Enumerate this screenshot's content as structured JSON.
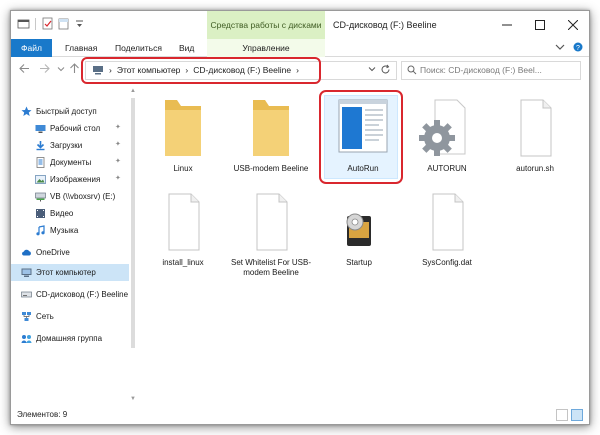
{
  "window": {
    "title": "CD-дисковод (F:) Beeline",
    "context_tab_header": "Средства работы с дисками"
  },
  "ribbon": {
    "tabs": [
      "Файл",
      "Главная",
      "Поделиться",
      "Вид",
      "Управление"
    ]
  },
  "address": {
    "crumbs": [
      "Этот компьютер",
      "CD-дисковод (F:) Beeline"
    ],
    "search_placeholder": "Поиск: CD-дисковод (F:) Beel..."
  },
  "sidebar": {
    "items": [
      {
        "label": "Быстрый доступ",
        "icon": "star-icon",
        "pinned": false
      },
      {
        "label": "Рабочий стол",
        "icon": "desktop-icon",
        "pinned": true
      },
      {
        "label": "Загрузки",
        "icon": "download-icon",
        "pinned": true
      },
      {
        "label": "Документы",
        "icon": "documents-icon",
        "pinned": true
      },
      {
        "label": "Изображения",
        "icon": "pictures-icon",
        "pinned": true
      },
      {
        "label": "VB (\\\\vboxsrv) (E:)",
        "icon": "network-drive-icon",
        "pinned": false
      },
      {
        "label": "Видео",
        "icon": "video-icon",
        "pinned": false
      },
      {
        "label": "Музыка",
        "icon": "music-icon",
        "pinned": false
      },
      {
        "label": "OneDrive",
        "icon": "cloud-icon",
        "pinned": false
      },
      {
        "label": "Этот компьютер",
        "icon": "computer-icon",
        "pinned": false
      },
      {
        "label": "CD-дисковод (F:) Beeline",
        "icon": "cd-drive-icon",
        "pinned": false
      },
      {
        "label": "Сеть",
        "icon": "network-icon",
        "pinned": false
      },
      {
        "label": "Домашняя группа",
        "icon": "homegroup-icon",
        "pinned": false
      }
    ]
  },
  "files": [
    {
      "name": "Linux",
      "kind": "folder"
    },
    {
      "name": "USB-modem Beeline",
      "kind": "folder"
    },
    {
      "name": "AutoRun",
      "kind": "exe"
    },
    {
      "name": "AUTORUN",
      "kind": "settings"
    },
    {
      "name": "autorun.sh",
      "kind": "file"
    },
    {
      "name": "install_linux",
      "kind": "file"
    },
    {
      "name": "Set Whitelist For USB-modem Beeline",
      "kind": "file"
    },
    {
      "name": "Startup",
      "kind": "app"
    },
    {
      "name": "SysConfig.dat",
      "kind": "file"
    }
  ],
  "status": {
    "items_count": "Элементов: 9"
  },
  "colors": {
    "accent": "#1979ca",
    "highlight_red": "#d9272e",
    "context_tab_green": "#dbf0c4",
    "selection": "#cce4f7",
    "folder": "#f4d177"
  }
}
